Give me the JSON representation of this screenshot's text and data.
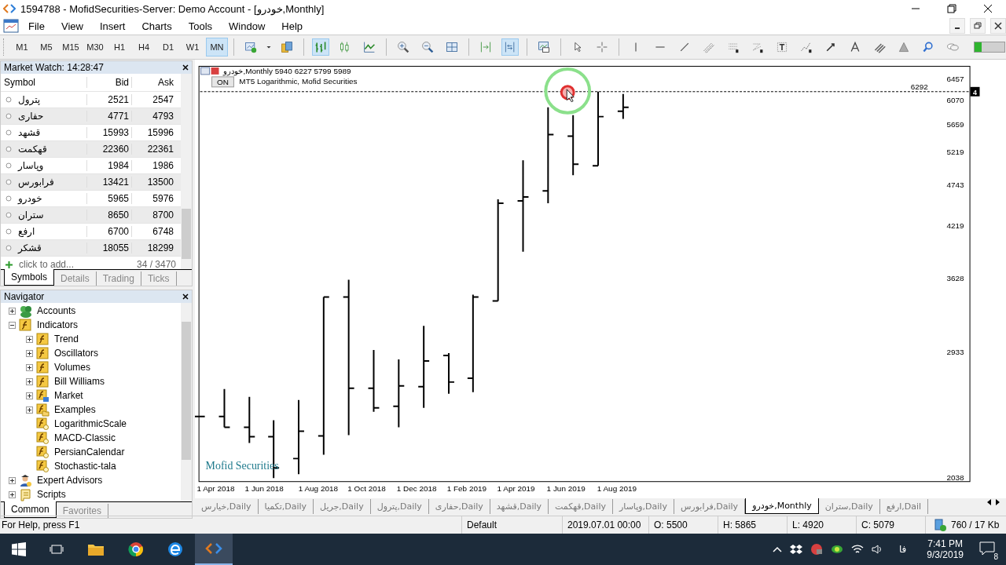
{
  "window": {
    "title": "1594788 - MofidSecurities-Server: Demo Account - [خودرو,Monthly]"
  },
  "menu": [
    "File",
    "View",
    "Insert",
    "Charts",
    "Tools",
    "Window",
    "Help"
  ],
  "timeframes": [
    {
      "label": "M1",
      "selected": false
    },
    {
      "label": "M5",
      "selected": false
    },
    {
      "label": "M15",
      "selected": false
    },
    {
      "label": "M30",
      "selected": false
    },
    {
      "label": "H1",
      "selected": false
    },
    {
      "label": "H4",
      "selected": false
    },
    {
      "label": "D1",
      "selected": false
    },
    {
      "label": "W1",
      "selected": false
    },
    {
      "label": "MN",
      "selected": true
    }
  ],
  "toolbar": {
    "chart_types": [
      {
        "selected": true
      },
      {
        "selected": false
      },
      {
        "selected": false
      }
    ],
    "auto_scroll": true
  },
  "market_watch": {
    "title": "Market Watch: 14:28:47",
    "columns": [
      "Symbol",
      "Bid",
      "Ask"
    ],
    "rows": [
      {
        "symbol": "پترول",
        "bid": "2521",
        "ask": "2547"
      },
      {
        "symbol": "حفاری",
        "bid": "4771",
        "ask": "4793"
      },
      {
        "symbol": "قشهد",
        "bid": "15993",
        "ask": "15996"
      },
      {
        "symbol": "قهکمت",
        "bid": "22360",
        "ask": "22361"
      },
      {
        "symbol": "وپاسار",
        "bid": "1984",
        "ask": "1986"
      },
      {
        "symbol": "فرابورس",
        "bid": "13421",
        "ask": "13500"
      },
      {
        "symbol": "خودرو",
        "bid": "5965",
        "ask": "5976"
      },
      {
        "symbol": "ستران",
        "bid": "8650",
        "ask": "8700"
      },
      {
        "symbol": "ارفع",
        "bid": "6700",
        "ask": "6748"
      },
      {
        "symbol": "قشکر",
        "bid": "18055",
        "ask": "18299"
      }
    ],
    "add_label": "click to add...",
    "count": "34 / 3470",
    "tabs": [
      {
        "label": "Symbols",
        "selected": true
      },
      {
        "label": "Details",
        "selected": false
      },
      {
        "label": "Trading",
        "selected": false
      },
      {
        "label": "Ticks",
        "selected": false
      }
    ]
  },
  "navigator": {
    "title": "Navigator",
    "tree": [
      {
        "label": "Accounts",
        "kind": "accounts",
        "expanded": false
      },
      {
        "label": "Indicators",
        "kind": "indicators",
        "expanded": true,
        "children": [
          {
            "label": "Trend",
            "kind": "indicator",
            "expanded": false
          },
          {
            "label": "Oscillators",
            "kind": "indicator",
            "expanded": false
          },
          {
            "label": "Volumes",
            "kind": "indicator",
            "expanded": false
          },
          {
            "label": "Bill Williams",
            "kind": "indicator",
            "expanded": false
          },
          {
            "label": "Market",
            "kind": "market",
            "expanded": false
          },
          {
            "label": "Examples",
            "kind": "folder",
            "expanded": false
          },
          {
            "label": "LogarithmicScale",
            "kind": "custom"
          },
          {
            "label": "MACD-Classic",
            "kind": "custom"
          },
          {
            "label": "PersianCalendar",
            "kind": "custom"
          },
          {
            "label": "Stochastic-tala",
            "kind": "custom"
          }
        ]
      },
      {
        "label": "Expert Advisors",
        "kind": "experts",
        "expanded": false
      },
      {
        "label": "Scripts",
        "kind": "scripts",
        "expanded": false
      }
    ],
    "tabs": [
      {
        "label": "Common",
        "selected": true
      },
      {
        "label": "Favorites",
        "selected": false
      }
    ]
  },
  "chart": {
    "symbol": "خودرو,Monthly",
    "ohlc": "5940 6227 5799 5989",
    "indicator_button": "ON",
    "indicator_label": "MT5 Logarithmic, Mofid Securities",
    "price_line": "6292",
    "marker": "4",
    "watermark": "Mofid Securities",
    "price_ticks": [
      "6457",
      "6070",
      "5659",
      "5219",
      "4743",
      "4219",
      "3628",
      "2933",
      "2038"
    ],
    "date_ticks": [
      "1 Apr 2018",
      "1 Jun 2018",
      "1 Aug 2018",
      "1 Oct 2018",
      "1 Dec 2018",
      "1 Feb 2019",
      "1 Apr 2019",
      "1 Jun 2019",
      "1 Aug 2019"
    ]
  },
  "chart_tabs": [
    {
      "label": "خيارس,Daily",
      "selected": false
    },
    {
      "label": "تكميا,Daily",
      "selected": false
    },
    {
      "label": "جريل,Daily",
      "selected": false
    },
    {
      "label": "پترول,Daily",
      "selected": false
    },
    {
      "label": "حفاری,Daily",
      "selected": false
    },
    {
      "label": "قشهد,Daily",
      "selected": false
    },
    {
      "label": "قهکمت,Daily",
      "selected": false
    },
    {
      "label": "وپاسار,Daily",
      "selected": false
    },
    {
      "label": "فرابورس,Daily",
      "selected": false
    },
    {
      "label": "خودرو,Monthly",
      "selected": true
    },
    {
      "label": "ستران,Daily",
      "selected": false
    },
    {
      "label": "ارفع,Dail",
      "selected": false
    }
  ],
  "status_bar": {
    "help": "For Help, press F1",
    "profile": "Default",
    "time": "2019.07.01 00:00",
    "open": "O: 5500",
    "high": "H: 5865",
    "low": "L: 4920",
    "close": "C: 5079",
    "traffic": "760 / 17 Kb"
  },
  "taskbar": {
    "language": "فا",
    "time": "7:41 PM",
    "date": "9/3/2019",
    "notifications": "8"
  }
}
